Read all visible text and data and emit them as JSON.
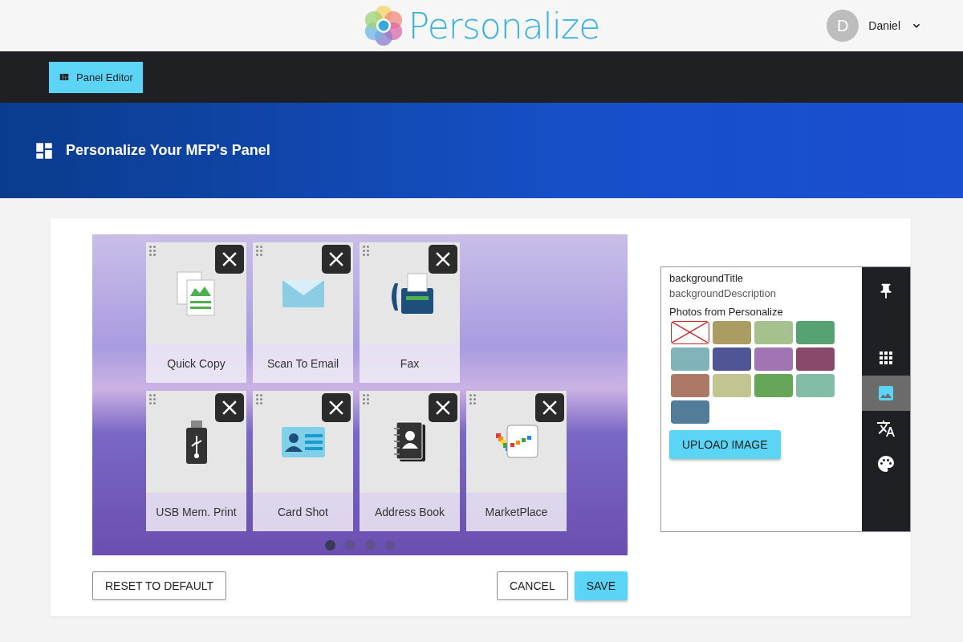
{
  "header": {
    "brand": "Personalize",
    "user": {
      "initial": "D",
      "name": "Daniel"
    }
  },
  "nav": {
    "button": "Panel Editor"
  },
  "banner": {
    "title": "Personalize Your MFP's Panel"
  },
  "preview": {
    "rows": [
      [
        {
          "label": "Quick Copy",
          "kind": "copy"
        },
        {
          "label": "Scan To Email",
          "kind": "email"
        },
        {
          "label": "Fax",
          "kind": "fax"
        }
      ],
      [
        {
          "label": "USB Mem. Print",
          "kind": "usb"
        },
        {
          "label": "Card Shot",
          "kind": "card"
        },
        {
          "label": "Address Book",
          "kind": "book"
        },
        {
          "label": "MarketPlace",
          "kind": "market"
        }
      ]
    ],
    "pages": [
      {
        "selected": true
      },
      {
        "selected": false
      },
      {
        "selected": false
      },
      {
        "selected": false
      }
    ]
  },
  "actions": {
    "reset": "RESET TO DEFAULT",
    "cancel": "CANCEL",
    "save": "SAVE"
  },
  "side_panel": {
    "title": "backgroundTitle",
    "description": "backgroundDescription",
    "photos_label": "Photos from Personalize",
    "photos": [
      {
        "kind": "none"
      },
      {
        "kind": "photo"
      },
      {
        "kind": "photo"
      },
      {
        "kind": "photo"
      },
      {
        "kind": "photo"
      },
      {
        "kind": "photo"
      },
      {
        "kind": "photo"
      },
      {
        "kind": "photo"
      },
      {
        "kind": "photo"
      },
      {
        "kind": "photo"
      },
      {
        "kind": "photo"
      },
      {
        "kind": "photo"
      },
      {
        "kind": "photo"
      }
    ],
    "upload": "UPLOAD IMAGE",
    "tools": [
      {
        "kind": "pin",
        "selected": false
      },
      {
        "kind": "grid",
        "selected": false
      },
      {
        "kind": "image",
        "selected": true
      },
      {
        "kind": "translate",
        "selected": false
      },
      {
        "kind": "palette",
        "selected": false
      }
    ]
  }
}
